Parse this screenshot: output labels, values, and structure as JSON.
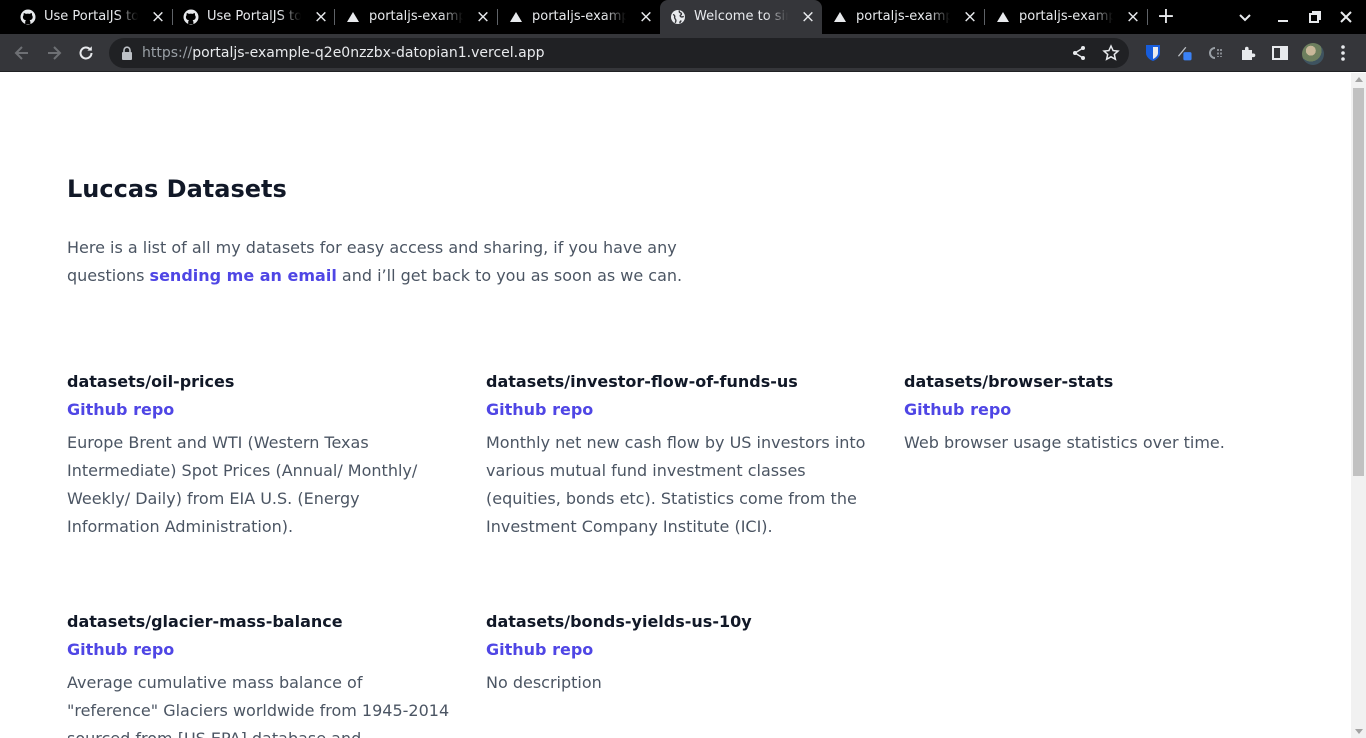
{
  "browser": {
    "tabs": [
      {
        "title": "Use PortalJS to",
        "favicon": "github-icon",
        "active": false
      },
      {
        "title": "Use PortalJS to",
        "favicon": "github-icon",
        "active": false
      },
      {
        "title": "portaljs-example",
        "favicon": "vercel-icon",
        "active": false
      },
      {
        "title": "portaljs-example",
        "favicon": "vercel-icon",
        "active": false
      },
      {
        "title": "Welcome to simple",
        "favicon": "globe-icon",
        "active": true
      },
      {
        "title": "portaljs-example",
        "favicon": "vercel-icon",
        "active": false
      },
      {
        "title": "portaljs-example",
        "favicon": "vercel-icon",
        "active": false
      }
    ],
    "url_scheme": "https://",
    "url_host": "portaljs-example-q2e0nzzbx-datopian1.vercel.app"
  },
  "page": {
    "title": "Luccas Datasets",
    "intro_before": "Here is a list of all my datasets for easy access and sharing, if you have any questions ",
    "intro_link": "sending me an email",
    "intro_after": " and i’ll get back to you as soon as we can.",
    "datasets": [
      {
        "name": "datasets/oil-prices",
        "link": "Github repo",
        "description": "Europe Brent and WTI (Western Texas Intermediate) Spot Prices (Annual/ Monthly/ Weekly/ Daily) from EIA U.S. (Energy Information Administration)."
      },
      {
        "name": "datasets/investor-flow-of-funds-us",
        "link": "Github repo",
        "description": "Monthly net new cash flow by US investors into various mutual fund investment classes (equities, bonds etc). Statistics come from the Investment Company Institute (ICI)."
      },
      {
        "name": "datasets/browser-stats",
        "link": "Github repo",
        "description": "Web browser usage statistics over time."
      },
      {
        "name": "datasets/glacier-mass-balance",
        "link": "Github repo",
        "description": "Average cumulative mass balance of \"reference\" Glaciers worldwide from 1945-2014 sourced from [US EPA] database and"
      },
      {
        "name": "datasets/bonds-yields-us-10y",
        "link": "Github repo",
        "description": "No description"
      }
    ]
  },
  "colors": {
    "accent": "#4f46e5",
    "heading": "#111827",
    "body_text": "#4b5563"
  }
}
